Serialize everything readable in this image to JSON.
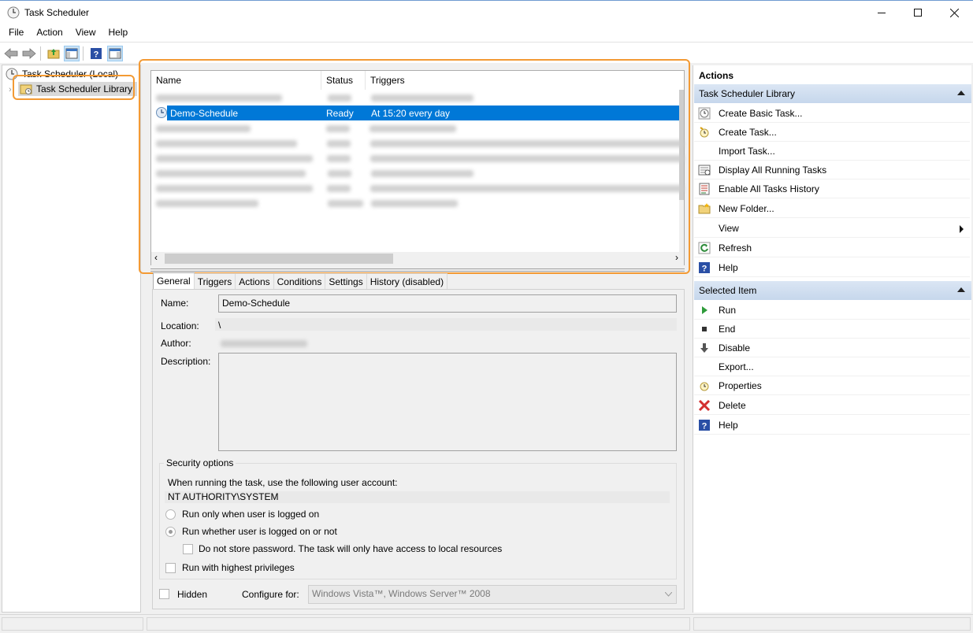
{
  "window": {
    "title": "Task Scheduler"
  },
  "menu": [
    "File",
    "Action",
    "View",
    "Help"
  ],
  "tree": {
    "root": "Task Scheduler (Local)",
    "library": "Task Scheduler Library"
  },
  "list": {
    "columns": [
      "Name",
      "Status",
      "Triggers"
    ],
    "selected": {
      "name": "Demo-Schedule",
      "status": "Ready",
      "triggers": "At 15:20 every day"
    }
  },
  "tabs": [
    "General",
    "Triggers",
    "Actions",
    "Conditions",
    "Settings",
    "History (disabled)"
  ],
  "general": {
    "name_label": "Name:",
    "name_value": "Demo-Schedule",
    "location_label": "Location:",
    "location_value": "\\",
    "author_label": "Author:",
    "description_label": "Description:",
    "security_title": "Security options",
    "account_prompt": "When running the task, use the following user account:",
    "account_value": "NT AUTHORITY\\SYSTEM",
    "radio_logged_on": "Run only when user is logged on",
    "radio_whether": "Run whether user is logged on or not",
    "no_store_password": "Do not store password.  The task will only have access to local resources",
    "highest_privileges": "Run with highest privileges",
    "hidden": "Hidden",
    "configure_for_label": "Configure for:",
    "configure_for_value": "Windows Vista™, Windows Server™ 2008"
  },
  "actions": {
    "title": "Actions",
    "library_section": "Task Scheduler Library",
    "library_items": [
      {
        "label": "Create Basic Task...",
        "icon": "create-basic-task-icon"
      },
      {
        "label": "Create Task...",
        "icon": "create-task-icon"
      },
      {
        "label": "Import Task...",
        "icon": ""
      },
      {
        "label": "Display All Running Tasks",
        "icon": "running-tasks-icon"
      },
      {
        "label": "Enable All Tasks History",
        "icon": "history-icon"
      },
      {
        "label": "New Folder...",
        "icon": "folder-icon"
      },
      {
        "label": "View",
        "icon": ""
      },
      {
        "label": "Refresh",
        "icon": "refresh-icon"
      },
      {
        "label": "Help",
        "icon": "help-icon"
      }
    ],
    "selected_section": "Selected Item",
    "selected_items": [
      {
        "label": "Run",
        "icon": "run-icon"
      },
      {
        "label": "End",
        "icon": "stop-icon"
      },
      {
        "label": "Disable",
        "icon": "disable-icon"
      },
      {
        "label": "Export...",
        "icon": ""
      },
      {
        "label": "Properties",
        "icon": "properties-icon"
      },
      {
        "label": "Delete",
        "icon": "delete-icon"
      },
      {
        "label": "Help",
        "icon": "help-icon"
      }
    ]
  },
  "colors": {
    "selection": "#0078d7",
    "highlight": "#f39a34",
    "section_header": "#c6d7ec"
  }
}
